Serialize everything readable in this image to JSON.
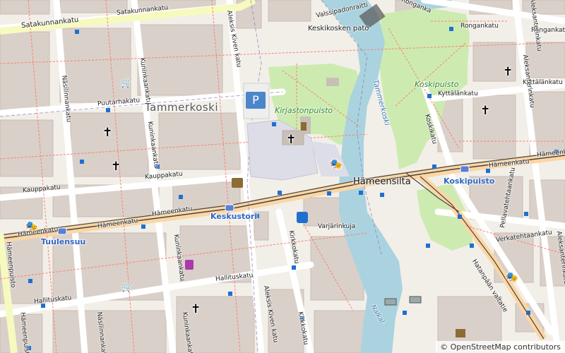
{
  "map": {
    "labels": {
      "satakunnankatu": "Satakunnankatu",
      "satakunnankatu_small": "Satakunnankatu",
      "keskikosken_pato": "Keskikosken pato",
      "valssipadonraitti": "Valssipadonraitti",
      "ronganka": "Ronganka",
      "rongankatu": "Rongankatu",
      "rongankatu2": "Rongankatu",
      "kyttalankatu_top": "Kyttälänkatu",
      "kyttalankatu": "Kyttälänkatu",
      "aleksis_kiven_katu_top": "Aleksis Kiven katu",
      "aleksis_kiven_katu_bottom": "Aleksis Kiven katu",
      "nasilinnankatu_top": "Näsilinnankatu",
      "nasilinnankatu_bottom": "Näsilinnankatu",
      "kuninkaankatu_1": "Kuninkaankatu",
      "kuninkaankatu_2": "Kuninkaankatu",
      "kuninkaankatu_3": "Kuninkaankatu",
      "kuninkaankatu_4": "Kuninkaankatu",
      "puutarhakatu": "Puutarhakatu",
      "tammerkoski_district": "Tammerkoski",
      "kirjastonpuisto": "Kirjastonpuisto",
      "koskipuisto_park": "Koskipuisto",
      "tammerkoski_river": "Tammerkoski",
      "kauppakatu_1": "Kauppakatu",
      "kauppakatu_2": "Kauppakatu",
      "hameenkatu_1": "Hämeenkatu",
      "hameenkatu_2": "Hämeenkatu",
      "hameenkatu_3": "Hämeenkatu",
      "hameenkatu_4": "Hämeenkatu",
      "hameenkatu_5": "Hämeenkatu",
      "hameensilta": "Hämeensilta",
      "koskipuisto_stop": "Koskipuisto",
      "keskustori": "Keskustori",
      "tuulensuu": "Tuulensuu",
      "varjarinkuja": "Varjärinkuja",
      "kirkkokatu_1": "Kirkkokatu",
      "kirkkokatu_2": "Kirkkokatu",
      "hallituskatu_1": "Hallituskatu",
      "hallituskatu_2": "Hallituskatu",
      "hameenpuisto_1": "Hämeenpuisto",
      "hameenpuisto_2": "Hämeenpuisto",
      "koskikatu": "Koskikatu",
      "pellavatehtaankatu": "Pellavatehtaankatu",
      "verkatehtaankatu": "Verkatehtaankatu",
      "aleksanterinkatu_1": "Aleksanterinkatu",
      "aleksanterinkatu_2": "Aleksanterinkatu",
      "aleksanterinkatu_3": "Aleksanterinkatu",
      "hatanpaan_valtatie": "Hatanpään valtatie",
      "nalkal": "Nalkal"
    },
    "attribution": "© OpenStreetMap contributors",
    "icons": {
      "parking": "P",
      "church": "✝",
      "shopping_cart": "🛒",
      "theatre": "🎭"
    },
    "colors": {
      "background": "#f2efe9",
      "building": "#d9d0c9",
      "building_outline": "#c9bdb3",
      "park": "#cdebb0",
      "water": "#aad3df",
      "road": "#ffffff",
      "primary_road": "#fcd6a4",
      "tram": "#444444",
      "footpath": "#fa8072",
      "boundary": "#8d7ab8",
      "stop_blue": "#1f6fd1"
    }
  }
}
